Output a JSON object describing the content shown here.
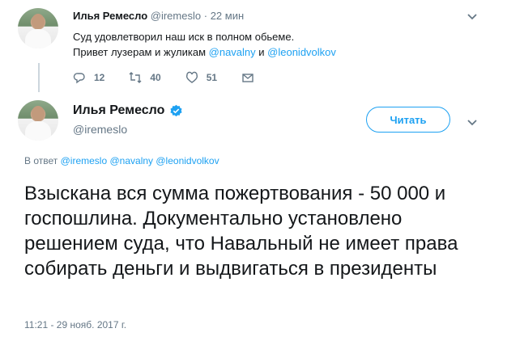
{
  "parent_tweet": {
    "author_name": "Илья Ремесло",
    "handle": "@iremeslo",
    "separator": "·",
    "time": "22 мин",
    "line1": "Суд удовлетворил наш иск  в полном обьеме.",
    "line2_prefix": "Привет лузерам и жуликам ",
    "mention1": "@navalny",
    "conj": " и ",
    "mention2": "@leonidvolkov",
    "replies": "12",
    "retweets": "40",
    "likes": "51"
  },
  "main_tweet": {
    "author_name": "Илья Ремесло",
    "handle": "@iremeslo",
    "follow_label": "Читать",
    "reply_prefix": "В ответ",
    "reply_mentions": [
      "@iremeslo",
      "@navalny",
      "@leonidvolkov"
    ],
    "text": "Взыскана вся сумма пожертвования - 50 000 и госпошлина. Документально установлено решением суда, что Навальный не имеет права собирать деньги и выдвигаться в президенты",
    "date": "11:21 - 29 нояб. 2017 г."
  },
  "colors": {
    "accent": "#1da1f2",
    "muted": "#657786",
    "text": "#14171a"
  },
  "icons": [
    "reply-icon",
    "retweet-icon",
    "like-icon",
    "dm-icon",
    "chevron-down-icon",
    "verified-badge-icon"
  ]
}
